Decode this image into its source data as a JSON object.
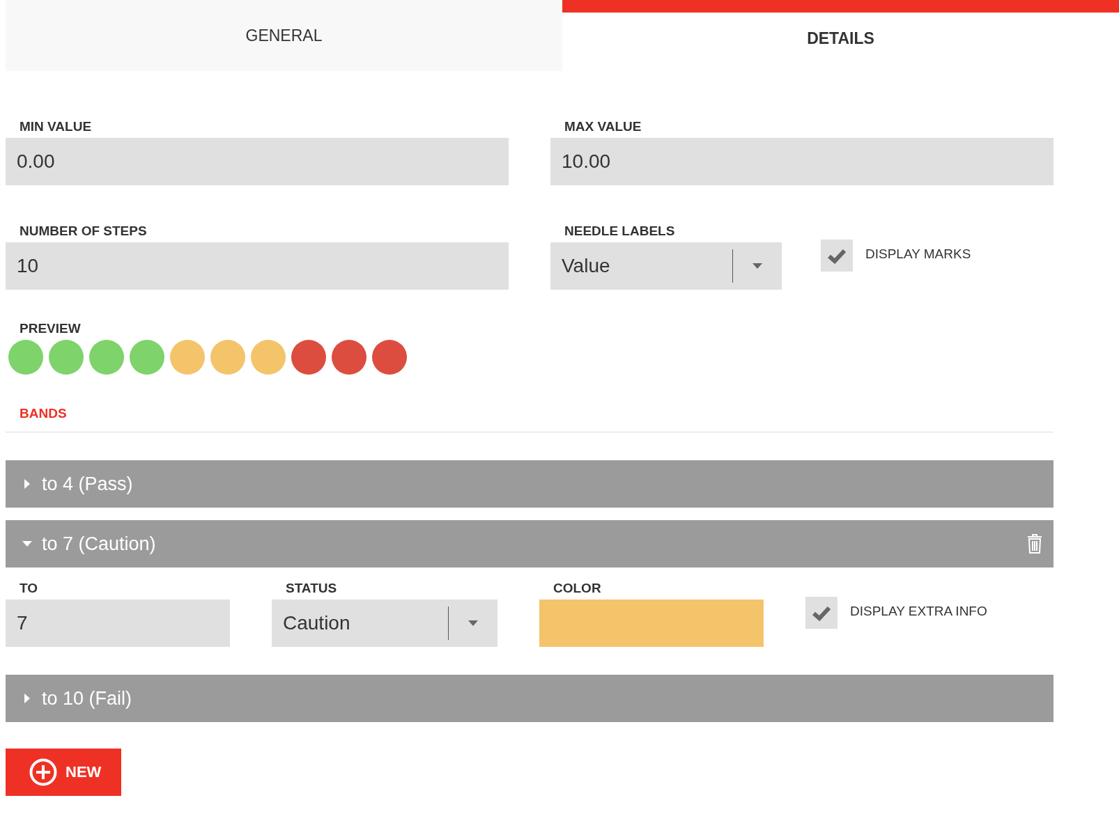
{
  "tabs": [
    {
      "label": "GENERAL",
      "selected": false
    },
    {
      "label": "DETAILS",
      "selected": true
    }
  ],
  "min_value": {
    "label": "MIN VALUE",
    "value": "0.00"
  },
  "max_value": {
    "label": "MAX VALUE",
    "value": "10.00"
  },
  "number_of_steps": {
    "label": "NUMBER OF STEPS",
    "value": "10"
  },
  "needle_labels": {
    "label": "NEEDLE LABELS",
    "value": "Value"
  },
  "display_marks": {
    "label": "DISPLAY MARKS",
    "checked": true
  },
  "preview": {
    "label": "PREVIEW",
    "dots": [
      {
        "color": "#7ed36b"
      },
      {
        "color": "#7ed36b"
      },
      {
        "color": "#7ed36b"
      },
      {
        "color": "#7ed36b"
      },
      {
        "color": "#f4c46b"
      },
      {
        "color": "#f4c46b"
      },
      {
        "color": "#f4c46b"
      },
      {
        "color": "#dc4d3f"
      },
      {
        "color": "#dc4d3f"
      },
      {
        "color": "#dc4d3f"
      }
    ]
  },
  "bands_heading": "BANDS",
  "bands": [
    {
      "title": "to 4 (Pass)",
      "expanded": false
    },
    {
      "title": "to 7 (Caution)",
      "expanded": true,
      "to": {
        "label": "TO",
        "value": "7"
      },
      "status": {
        "label": "STATUS",
        "value": "Caution"
      },
      "color_field": {
        "label": "COLOR",
        "color": "#f4c46b"
      },
      "display_extra_info": {
        "label": "DISPLAY EXTRA INFO",
        "checked": true
      }
    },
    {
      "title": "to 10 (Fail)",
      "expanded": false
    }
  ],
  "new_button": "NEW"
}
